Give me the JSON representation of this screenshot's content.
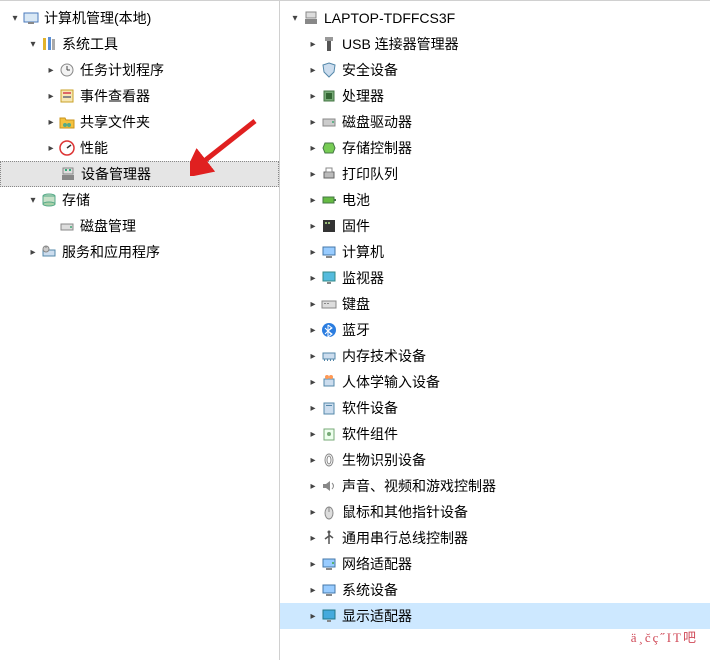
{
  "left_tree": {
    "root": "计算机管理(本地)",
    "system_tools": "系统工具",
    "task_scheduler": "任务计划程序",
    "event_viewer": "事件查看器",
    "shared_folders": "共享文件夹",
    "performance": "性能",
    "device_manager": "设备管理器",
    "storage": "存储",
    "disk_management": "磁盘管理",
    "services_apps": "服务和应用程序"
  },
  "right_tree": {
    "root": "LAPTOP-TDFFCS3F",
    "items": [
      "USB 连接器管理器",
      "安全设备",
      "处理器",
      "磁盘驱动器",
      "存储控制器",
      "打印队列",
      "电池",
      "固件",
      "计算机",
      "监视器",
      "键盘",
      "蓝牙",
      "内存技术设备",
      "人体学输入设备",
      "软件设备",
      "软件组件",
      "生物识别设备",
      "声音、视频和游戏控制器",
      "鼠标和其他指针设备",
      "通用串行总线控制器",
      "网络适配器",
      "系统设备",
      "显示适配器"
    ]
  },
  "watermark": "ä¸čç˝IT吧"
}
